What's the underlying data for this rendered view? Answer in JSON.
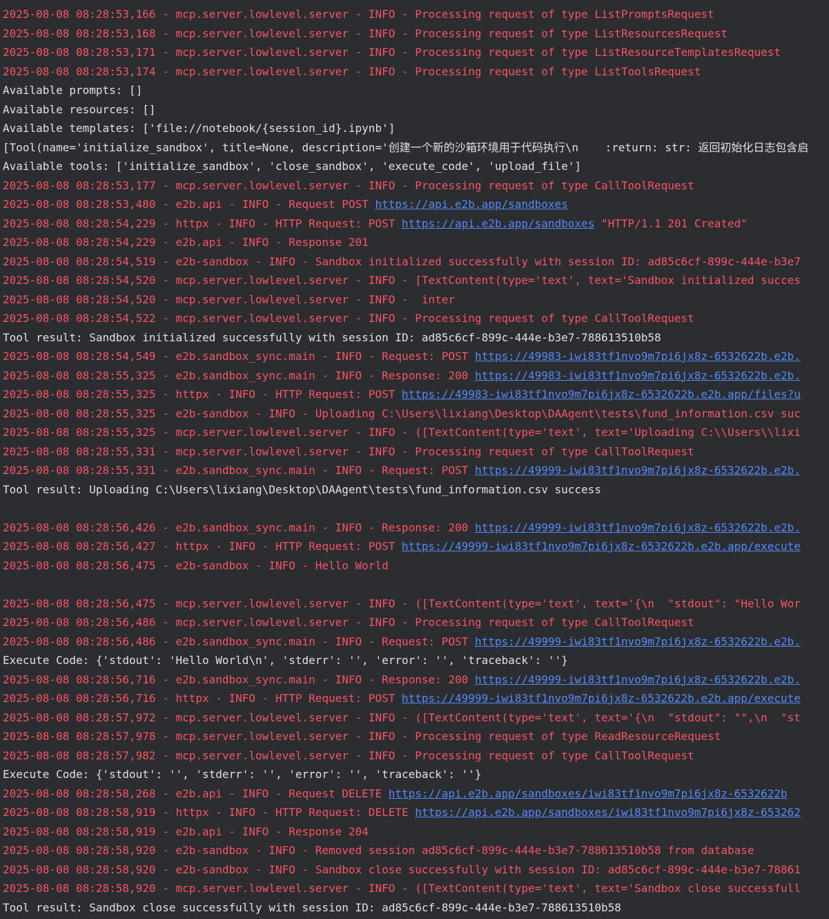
{
  "theme": {
    "background": "#2b2d30",
    "stderr_color": "#f75464",
    "stdout_color": "#dfe1e5",
    "link_color": "#548af7"
  },
  "lines": [
    {
      "kind": "err",
      "text": "2025-08-08 08:28:53,166 - mcp.server.lowlevel.server - INFO - Processing request of type ListPromptsRequest"
    },
    {
      "kind": "err",
      "text": "2025-08-08 08:28:53,168 - mcp.server.lowlevel.server - INFO - Processing request of type ListResourcesRequest"
    },
    {
      "kind": "err",
      "text": "2025-08-08 08:28:53,171 - mcp.server.lowlevel.server - INFO - Processing request of type ListResourceTemplatesRequest"
    },
    {
      "kind": "err",
      "text": "2025-08-08 08:28:53,174 - mcp.server.lowlevel.server - INFO - Processing request of type ListToolsRequest"
    },
    {
      "kind": "out",
      "text": "Available prompts: []"
    },
    {
      "kind": "out",
      "text": "Available resources: []"
    },
    {
      "kind": "out",
      "text": "Available templates: ['file://notebook/{session_id}.ipynb']"
    },
    {
      "kind": "out",
      "text": "[Tool(name='initialize_sandbox', title=None, description='创建一个新的沙箱环境用于代码执行\\n    :return: str: 返回初始化日志包含启"
    },
    {
      "kind": "out",
      "text": "Available tools: ['initialize_sandbox', 'close_sandbox', 'execute_code', 'upload_file']"
    },
    {
      "kind": "err",
      "text": "2025-08-08 08:28:53,177 - mcp.server.lowlevel.server - INFO - Processing request of type CallToolRequest"
    },
    {
      "kind": "err",
      "text": "2025-08-08 08:28:53,480 - e2b.api - INFO - Request POST ",
      "link": "https://api.e2b.app/sandboxes"
    },
    {
      "kind": "err",
      "text": "2025-08-08 08:28:54,229 - httpx - INFO - HTTP Request: POST ",
      "link": "https://api.e2b.app/sandboxes",
      "after": " \"HTTP/1.1 201 Created\""
    },
    {
      "kind": "err",
      "text": "2025-08-08 08:28:54,229 - e2b.api - INFO - Response 201"
    },
    {
      "kind": "err",
      "text": "2025-08-08 08:28:54,519 - e2b-sandbox - INFO - Sandbox initialized successfully with session ID: ad85c6cf-899c-444e-b3e7"
    },
    {
      "kind": "err",
      "text": "2025-08-08 08:28:54,520 - mcp.server.lowlevel.server - INFO - [TextContent(type='text', text='Sandbox initialized succes"
    },
    {
      "kind": "err",
      "text": "2025-08-08 08:28:54,520 - mcp.server.lowlevel.server - INFO -  inter"
    },
    {
      "kind": "err",
      "text": "2025-08-08 08:28:54,522 - mcp.server.lowlevel.server - INFO - Processing request of type CallToolRequest"
    },
    {
      "kind": "out",
      "text": "Tool result: Sandbox initialized successfully with session ID: ad85c6cf-899c-444e-b3e7-788613510b58"
    },
    {
      "kind": "err",
      "text": "2025-08-08 08:28:54,549 - e2b.sandbox_sync.main - INFO - Request: POST ",
      "link": "https://49983-iwi83tf1nvo9m7pi6jx8z-6532622b.e2b."
    },
    {
      "kind": "err",
      "text": "2025-08-08 08:28:55,325 - e2b.sandbox_sync.main - INFO - Response: 200 ",
      "link": "https://49983-iwi83tf1nvo9m7pi6jx8z-6532622b.e2b."
    },
    {
      "kind": "err",
      "text": "2025-08-08 08:28:55,325 - httpx - INFO - HTTP Request: POST ",
      "link": "https://49983-iwi83tf1nvo9m7pi6jx8z-6532622b.e2b.app/files?u"
    },
    {
      "kind": "err",
      "text": "2025-08-08 08:28:55,325 - e2b-sandbox - INFO - Uploading C:\\Users\\lixiang\\Desktop\\DAAgent\\tests\\fund_information.csv suc"
    },
    {
      "kind": "err",
      "text": "2025-08-08 08:28:55,325 - mcp.server.lowlevel.server - INFO - ([TextContent(type='text', text='Uploading C:\\\\Users\\\\lixi"
    },
    {
      "kind": "err",
      "text": "2025-08-08 08:28:55,331 - mcp.server.lowlevel.server - INFO - Processing request of type CallToolRequest"
    },
    {
      "kind": "err",
      "text": "2025-08-08 08:28:55,331 - e2b.sandbox_sync.main - INFO - Request: POST ",
      "link": "https://49999-iwi83tf1nvo9m7pi6jx8z-6532622b.e2b."
    },
    {
      "kind": "out",
      "text": "Tool result: Uploading C:\\Users\\lixiang\\Desktop\\DAAgent\\tests\\fund_information.csv success"
    },
    {
      "kind": "blank",
      "text": ""
    },
    {
      "kind": "err",
      "text": "2025-08-08 08:28:56,426 - e2b.sandbox_sync.main - INFO - Response: 200 ",
      "link": "https://49999-iwi83tf1nvo9m7pi6jx8z-6532622b.e2b."
    },
    {
      "kind": "err",
      "text": "2025-08-08 08:28:56,427 - httpx - INFO - HTTP Request: POST ",
      "link": "https://49999-iwi83tf1nvo9m7pi6jx8z-6532622b.e2b.app/execute"
    },
    {
      "kind": "err",
      "text": "2025-08-08 08:28:56,475 - e2b-sandbox - INFO - Hello World"
    },
    {
      "kind": "blank",
      "text": ""
    },
    {
      "kind": "err",
      "text": "2025-08-08 08:28:56,475 - mcp.server.lowlevel.server - INFO - ([TextContent(type='text', text='{\\n  \"stdout\": \"Hello Wor"
    },
    {
      "kind": "err",
      "text": "2025-08-08 08:28:56,486 - mcp.server.lowlevel.server - INFO - Processing request of type CallToolRequest"
    },
    {
      "kind": "err",
      "text": "2025-08-08 08:28:56,486 - e2b.sandbox_sync.main - INFO - Request: POST ",
      "link": "https://49999-iwi83tf1nvo9m7pi6jx8z-6532622b.e2b."
    },
    {
      "kind": "out",
      "text": "Execute Code: {'stdout': 'Hello World\\n', 'stderr': '', 'error': '', 'traceback': ''}"
    },
    {
      "kind": "err",
      "text": "2025-08-08 08:28:56,716 - e2b.sandbox_sync.main - INFO - Response: 200 ",
      "link": "https://49999-iwi83tf1nvo9m7pi6jx8z-6532622b.e2b."
    },
    {
      "kind": "err",
      "text": "2025-08-08 08:28:56,716 - httpx - INFO - HTTP Request: POST ",
      "link": "https://49999-iwi83tf1nvo9m7pi6jx8z-6532622b.e2b.app/execute"
    },
    {
      "kind": "err",
      "text": "2025-08-08 08:28:57,972 - mcp.server.lowlevel.server - INFO - ([TextContent(type='text', text='{\\n  \"stdout\": \"\",\\n  \"st"
    },
    {
      "kind": "err",
      "text": "2025-08-08 08:28:57,978 - mcp.server.lowlevel.server - INFO - Processing request of type ReadResourceRequest"
    },
    {
      "kind": "err",
      "text": "2025-08-08 08:28:57,982 - mcp.server.lowlevel.server - INFO - Processing request of type CallToolRequest"
    },
    {
      "kind": "out",
      "text": "Execute Code: {'stdout': '', 'stderr': '', 'error': '', 'traceback': ''}"
    },
    {
      "kind": "err",
      "text": "2025-08-08 08:28:58,268 - e2b.api - INFO - Request DELETE ",
      "link": "https://api.e2b.app/sandboxes/iwi83tf1nvo9m7pi6jx8z-6532622b"
    },
    {
      "kind": "err",
      "text": "2025-08-08 08:28:58,919 - httpx - INFO - HTTP Request: DELETE ",
      "link": "https://api.e2b.app/sandboxes/iwi83tf1nvo9m7pi6jx8z-653262"
    },
    {
      "kind": "err",
      "text": "2025-08-08 08:28:58,919 - e2b.api - INFO - Response 204"
    },
    {
      "kind": "err",
      "text": "2025-08-08 08:28:58,920 - e2b-sandbox - INFO - Removed session ad85c6cf-899c-444e-b3e7-788613510b58 from database"
    },
    {
      "kind": "err",
      "text": "2025-08-08 08:28:58,920 - e2b-sandbox - INFO - Sandbox close successfully with session ID: ad85c6cf-899c-444e-b3e7-78861"
    },
    {
      "kind": "err",
      "text": "2025-08-08 08:28:58,920 - mcp.server.lowlevel.server - INFO - ([TextContent(type='text', text='Sandbox close successfull"
    },
    {
      "kind": "out",
      "text": "Tool result: Sandbox close successfully with session ID: ad85c6cf-899c-444e-b3e7-788613510b58"
    }
  ]
}
